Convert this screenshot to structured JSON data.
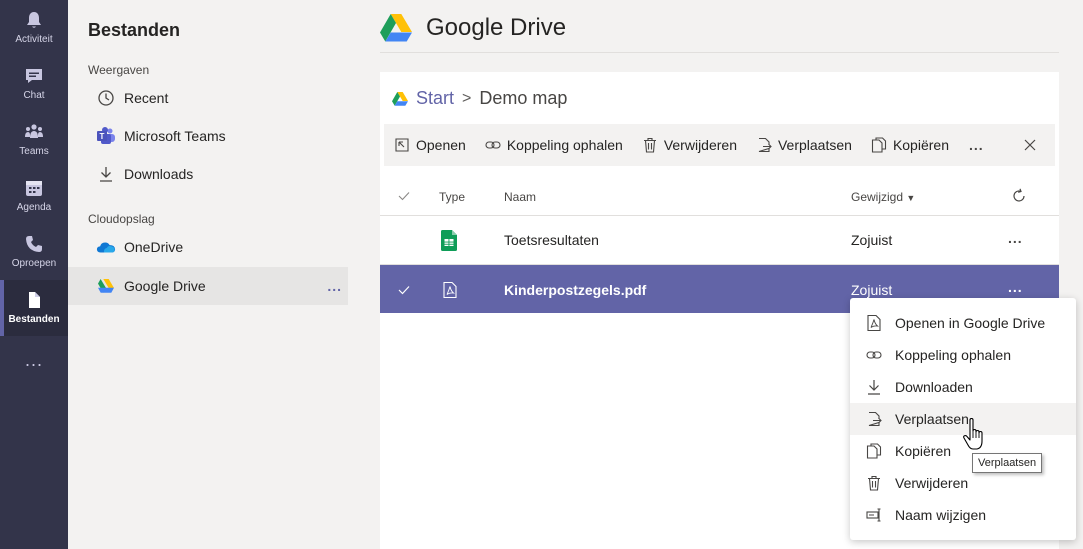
{
  "rail": {
    "items": [
      {
        "label": "Activiteit",
        "icon": "bell-icon"
      },
      {
        "label": "Chat",
        "icon": "chat-icon"
      },
      {
        "label": "Teams",
        "icon": "teams-icon"
      },
      {
        "label": "Agenda",
        "icon": "calendar-icon"
      },
      {
        "label": "Oproepen",
        "icon": "phone-icon"
      },
      {
        "label": "Bestanden",
        "icon": "file-icon",
        "active": true
      }
    ],
    "more": "..."
  },
  "panel": {
    "title": "Bestanden",
    "views_label": "Weergaven",
    "views": [
      {
        "label": "Recent",
        "icon": "clock-icon"
      },
      {
        "label": "Microsoft Teams",
        "icon": "ms-teams-logo-icon"
      },
      {
        "label": "Downloads",
        "icon": "download-icon"
      }
    ],
    "cloud_label": "Cloudopslag",
    "cloud": [
      {
        "label": "OneDrive",
        "icon": "onedrive-icon"
      },
      {
        "label": "Google Drive",
        "icon": "google-drive-icon",
        "active": true
      }
    ],
    "more": "..."
  },
  "main": {
    "title": "Google Drive",
    "breadcrumb": {
      "start": "Start",
      "separator": ">",
      "current": "Demo map"
    },
    "toolbar": {
      "open": "Openen",
      "link": "Koppeling ophalen",
      "delete": "Verwijderen",
      "move": "Verplaatsen",
      "copy": "Kopiëren",
      "more": "..."
    },
    "columns": {
      "type": "Type",
      "name": "Naam",
      "modified": "Gewijzigd"
    },
    "files": [
      {
        "name": "Toetsresultaten",
        "modified": "Zojuist",
        "type_icon": "google-sheets-icon",
        "selected": false
      },
      {
        "name": "Kinderpostzegels.pdf",
        "modified": "Zojuist",
        "type_icon": "pdf-file-icon",
        "selected": true
      }
    ],
    "row_more": "..."
  },
  "context_menu": {
    "items": [
      {
        "label": "Openen in Google Drive",
        "icon": "pdf-file-icon"
      },
      {
        "label": "Koppeling ophalen",
        "icon": "link-icon"
      },
      {
        "label": "Downloaden",
        "icon": "download-icon"
      },
      {
        "label": "Verplaatsen",
        "icon": "move-icon",
        "hover": true
      },
      {
        "label": "Kopiëren",
        "icon": "copy-icon"
      },
      {
        "label": "Verwijderen",
        "icon": "trash-icon"
      },
      {
        "label": "Naam wijzigen",
        "icon": "rename-icon"
      }
    ]
  },
  "tooltip": "Verplaatsen",
  "colors": {
    "accent": "#6264a7",
    "rail": "#33344a",
    "sheets_green": "#0f9d58"
  }
}
